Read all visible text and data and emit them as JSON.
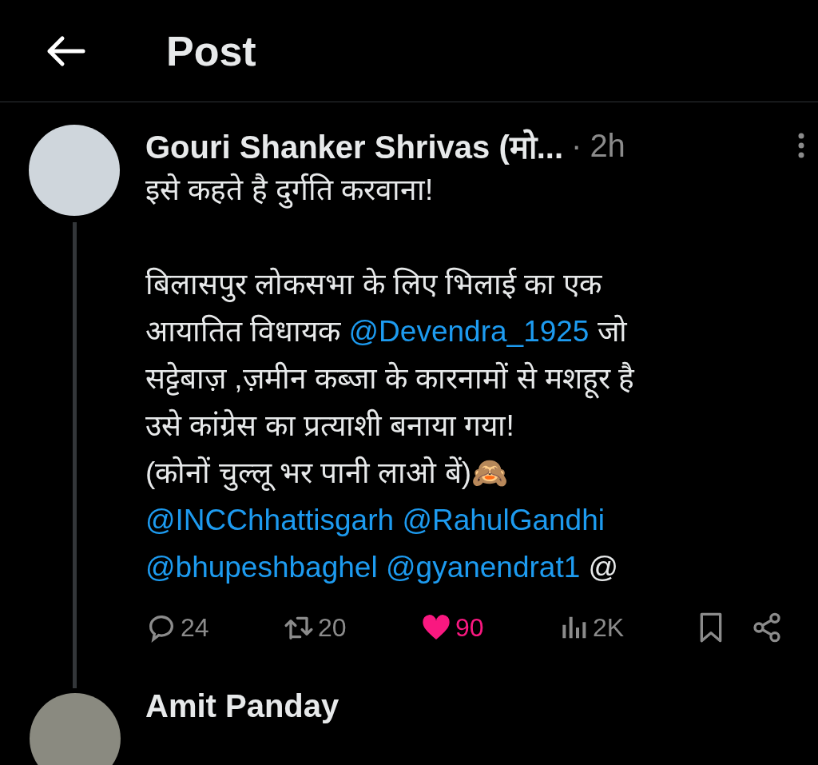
{
  "header": {
    "title": "Post"
  },
  "post": {
    "author": "Gouri Shanker Shrivas (मो...",
    "separator": "·",
    "time": "2h",
    "paragraphs": [
      [
        [
          {
            "kind": "text",
            "text": "इसे कहते है दुर्गति करवाना!"
          }
        ]
      ],
      [
        [
          {
            "kind": "text",
            "text": "बिलासपुर लोकसभा के लिए भिलाई का एक"
          }
        ],
        [
          {
            "kind": "text",
            "text": "आयातित विधायक "
          },
          {
            "kind": "mention",
            "text": "@Devendra_1925"
          },
          {
            "kind": "text",
            "text": " जो"
          }
        ],
        [
          {
            "kind": "text",
            "text": "सट्टेबाज़ ,ज़मीन कब्जा के कारनामों से मशहूर है"
          }
        ],
        [
          {
            "kind": "text",
            "text": "उसे कांग्रेस का प्रत्याशी बनाया गया!"
          }
        ],
        [
          {
            "kind": "text",
            "text": "(कोनों चुल्लू भर पानी लाओ बें)🙈"
          }
        ],
        [
          {
            "kind": "mention",
            "text": "@INCChhattisgarh"
          },
          {
            "kind": "mention",
            "text": "@RahulGandhi"
          }
        ],
        [
          {
            "kind": "mention",
            "text": "@bhupeshbaghel"
          },
          {
            "kind": "mention",
            "text": "@gyanendrat1"
          },
          {
            "kind": "text",
            "text": " @"
          }
        ]
      ]
    ],
    "actions": [
      {
        "kind": "reply",
        "count": "24",
        "active": false
      },
      {
        "kind": "repost",
        "count": "20",
        "active": false
      },
      {
        "kind": "like",
        "count": "90",
        "active": true
      },
      {
        "kind": "views",
        "count": "2K",
        "active": false
      },
      {
        "kind": "bookmark",
        "active": false
      },
      {
        "kind": "share",
        "active": false
      }
    ]
  },
  "next_reply": {
    "author": "Amit Panday"
  }
}
